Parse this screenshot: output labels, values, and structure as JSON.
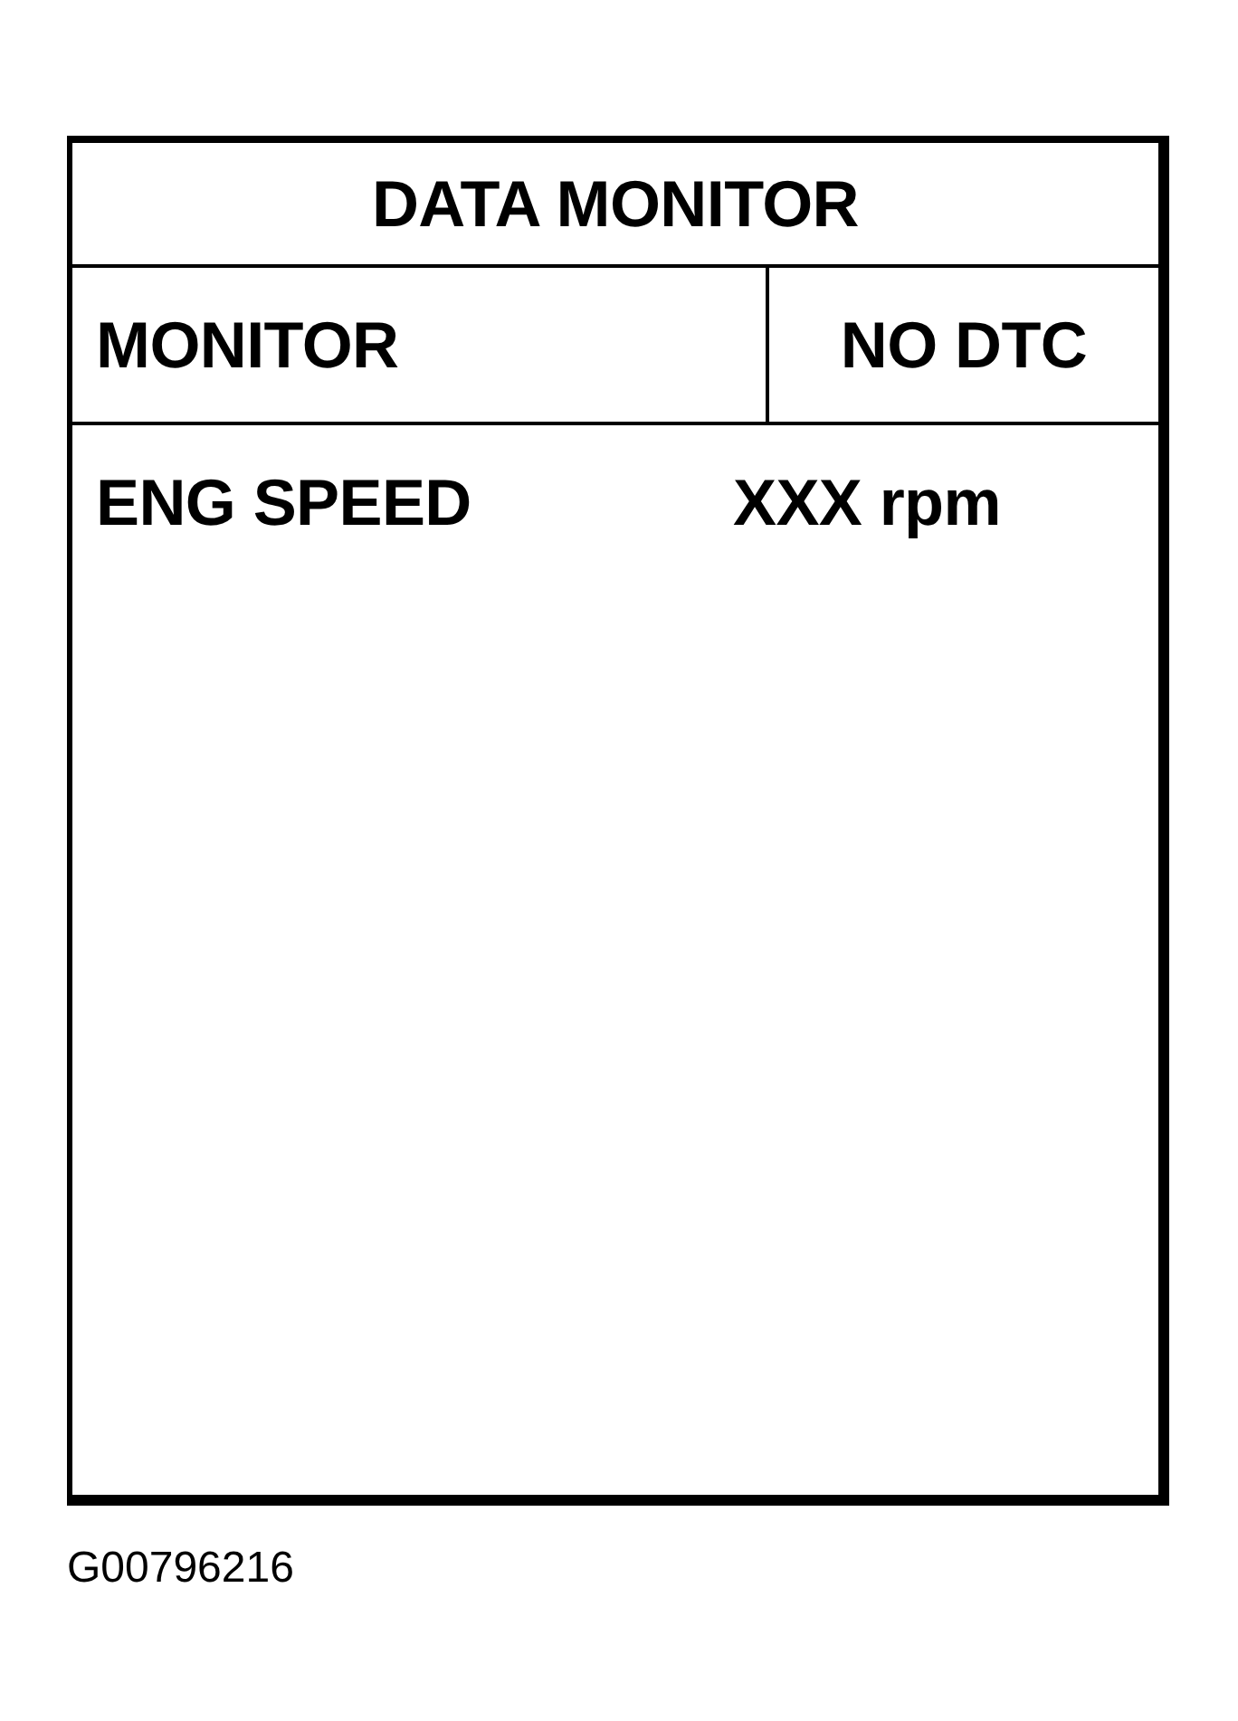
{
  "panel": {
    "title": "DATA MONITOR",
    "header": {
      "mode": "MONITOR",
      "status": "NO DTC"
    },
    "rows": [
      {
        "label": "ENG SPEED",
        "value": "XXX rpm"
      }
    ]
  },
  "figure_code": "G00796216"
}
